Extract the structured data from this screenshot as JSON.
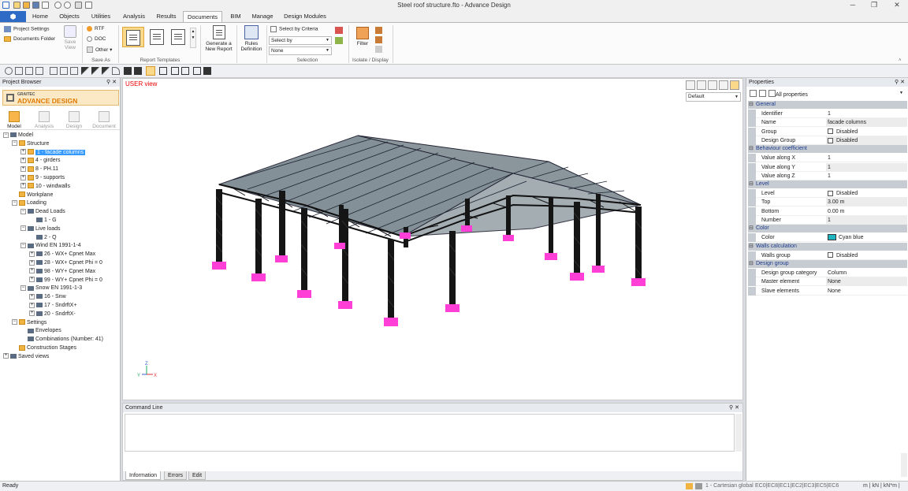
{
  "window": {
    "title": "Steel roof structure.fto - Advance Design",
    "minimize": "─",
    "restore": "❐",
    "close": "✕"
  },
  "ribbon": {
    "tabs": [
      "Home",
      "Objects",
      "Utilities",
      "Analysis",
      "Results",
      "Documents",
      "BIM",
      "Manage",
      "Design Modules"
    ],
    "active_tab": "Documents",
    "project_settings": "Project Settings",
    "documents_folder": "Documents Folder",
    "save_view": "Save View",
    "rtf": "RTF",
    "doc": "DOC",
    "other": "Other",
    "save_as_label": "Save As",
    "report_templates_label": "Report Templates",
    "generate_report": "Generate a New Report",
    "rules_definition": "Rules Definition",
    "select_by_criteria": "Select by Criteria",
    "select_by": "Select by",
    "none": "None",
    "selection_label": "Selection",
    "filter": "Filter",
    "isolate_label": "Isolate / Display"
  },
  "browser": {
    "title": "Project Browser",
    "logo_top": "GRAITEC",
    "logo_main": "ADVANCE DESIGN",
    "modes": [
      "Model",
      "Analysis",
      "Design",
      "Document"
    ],
    "tree": [
      {
        "label": "Model",
        "level": 0,
        "exp": "−"
      },
      {
        "label": "Structure",
        "level": 1,
        "exp": "−"
      },
      {
        "label": "1 - facade columns",
        "level": 2,
        "exp": "+",
        "selected": true
      },
      {
        "label": "4 - girders",
        "level": 2,
        "exp": "+"
      },
      {
        "label": "8 - PH.11",
        "level": 2,
        "exp": "+"
      },
      {
        "label": "9 - supports",
        "level": 2,
        "exp": "+"
      },
      {
        "label": "10 - windwalls",
        "level": 2,
        "exp": "+"
      },
      {
        "label": "Workplane",
        "level": 1,
        "exp": ""
      },
      {
        "label": "Loading",
        "level": 1,
        "exp": "−"
      },
      {
        "label": "Dead Loads",
        "level": 2,
        "exp": "−"
      },
      {
        "label": "1 - G",
        "level": 3,
        "exp": ""
      },
      {
        "label": "Live loads",
        "level": 2,
        "exp": "−"
      },
      {
        "label": "2 - Q",
        "level": 3,
        "exp": ""
      },
      {
        "label": "Wind EN 1991-1-4",
        "level": 2,
        "exp": "−"
      },
      {
        "label": "26 - WX+ Cpnet Max",
        "level": 3,
        "exp": "+"
      },
      {
        "label": "28 - WX+ Cpnet Phi = 0",
        "level": 3,
        "exp": "+"
      },
      {
        "label": "98 - WY+ Cpnet Max",
        "level": 3,
        "exp": "+"
      },
      {
        "label": "99 - WY+ Cpnet Phi = 0",
        "level": 3,
        "exp": "+"
      },
      {
        "label": "Snow EN 1991-1-3",
        "level": 2,
        "exp": "−"
      },
      {
        "label": "16 - Snw",
        "level": 3,
        "exp": "+"
      },
      {
        "label": "17 - SndrftX+",
        "level": 3,
        "exp": "+"
      },
      {
        "label": "20 - SndrftX-",
        "level": 3,
        "exp": "+"
      },
      {
        "label": "Settings",
        "level": 1,
        "exp": "−"
      },
      {
        "label": "Envelopes",
        "level": 2,
        "exp": ""
      },
      {
        "label": "Combinations (Number: 41)",
        "level": 2,
        "exp": ""
      },
      {
        "label": "Construction Stages",
        "level": 1,
        "exp": ""
      },
      {
        "label": "Saved views",
        "level": 0,
        "exp": "+"
      }
    ]
  },
  "viewport": {
    "label": "USER view",
    "view_combo": "Default",
    "axis_y": "Y",
    "axis_x": "X",
    "axis_z": "Z"
  },
  "command_line": {
    "title": "Command Line",
    "tabs": [
      "Information",
      "Errors",
      "Edit"
    ]
  },
  "properties": {
    "title": "Properties",
    "filter": "All properties",
    "sections": [
      {
        "name": "General",
        "rows": [
          {
            "name": "Identifier",
            "value": "1"
          },
          {
            "name": "Name",
            "value": "facade columns"
          },
          {
            "name": "Group",
            "value": "Disabled",
            "checkbox": true
          },
          {
            "name": "Design Group",
            "value": "Disabled",
            "checkbox": true
          }
        ]
      },
      {
        "name": "Behaviour coefficient",
        "rows": [
          {
            "name": "Value along X",
            "value": "1"
          },
          {
            "name": "Value along Y",
            "value": "1"
          },
          {
            "name": "Value along Z",
            "value": "1"
          }
        ]
      },
      {
        "name": "Level",
        "rows": [
          {
            "name": "Level",
            "value": "Disabled",
            "checkbox": true
          },
          {
            "name": "Top",
            "value": "3.00 m"
          },
          {
            "name": "Bottom",
            "value": "0.00 m"
          },
          {
            "name": "Number",
            "value": "1"
          }
        ]
      },
      {
        "name": "Color",
        "rows": [
          {
            "name": "Color",
            "value": "Cyan blue",
            "swatch": "#1fb5c0"
          }
        ]
      },
      {
        "name": "Walls calculation",
        "rows": [
          {
            "name": "Walls group",
            "value": "Disabled",
            "checkbox": true
          }
        ]
      },
      {
        "name": "Design group",
        "rows": [
          {
            "name": "Design group category",
            "value": "Column"
          },
          {
            "name": "Master element",
            "value": "None"
          },
          {
            "name": "Slave elements",
            "value": "None"
          }
        ]
      }
    ]
  },
  "status": {
    "left": "Ready",
    "coord": "1 - Cartesian global",
    "codes": "EC0|EC8|EC1|EC2|EC3|EC5|EC6",
    "units": "m | kN | kN*m | mm"
  },
  "colors": {
    "accent": "#2d6bc7",
    "support": "#ff3fd6",
    "steel": "#1a1a1a"
  }
}
